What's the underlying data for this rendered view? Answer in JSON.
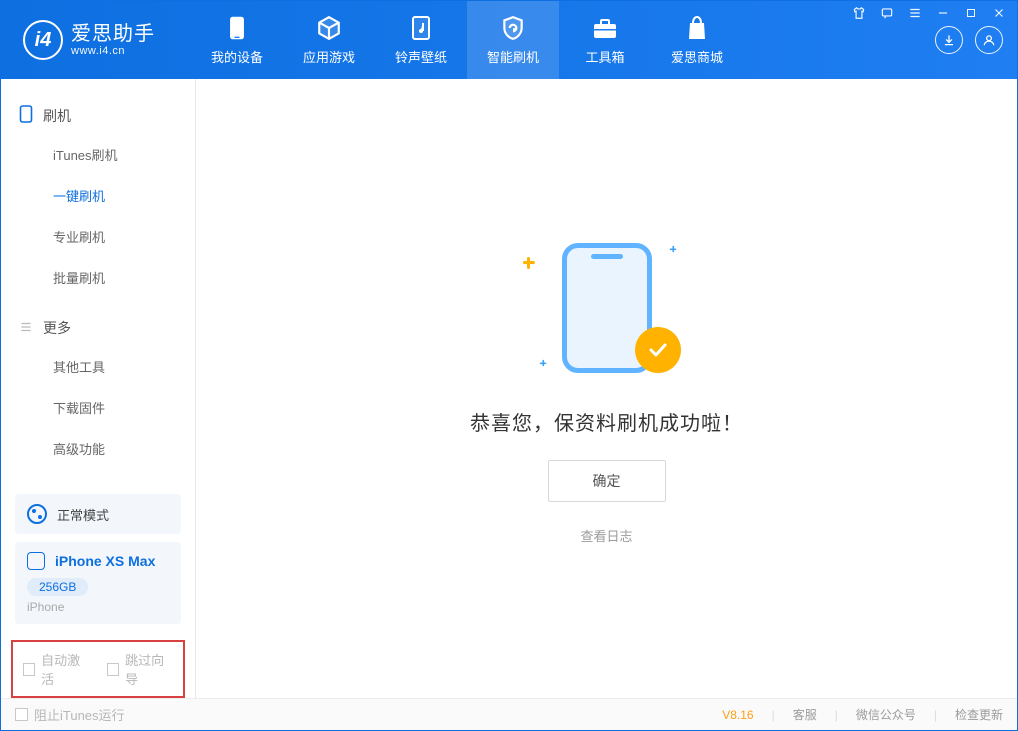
{
  "app": {
    "title": "爱思助手",
    "url": "www.i4.cn"
  },
  "tabs": [
    {
      "label": "我的设备"
    },
    {
      "label": "应用游戏"
    },
    {
      "label": "铃声壁纸"
    },
    {
      "label": "智能刷机"
    },
    {
      "label": "工具箱"
    },
    {
      "label": "爱思商城"
    }
  ],
  "sidebar": {
    "group1": {
      "title": "刷机",
      "items": [
        "iTunes刷机",
        "一键刷机",
        "专业刷机",
        "批量刷机"
      ]
    },
    "group2": {
      "title": "更多",
      "items": [
        "其他工具",
        "下载固件",
        "高级功能"
      ]
    },
    "mode": "正常模式",
    "device": {
      "name": "iPhone XS Max",
      "storage": "256GB",
      "type": "iPhone"
    },
    "check1": "自动激活",
    "check2": "跳过向导"
  },
  "main": {
    "success": "恭喜您，保资料刷机成功啦！",
    "ok": "确定",
    "log": "查看日志"
  },
  "footer": {
    "block_itunes": "阻止iTunes运行",
    "version": "V8.16",
    "links": [
      "客服",
      "微信公众号",
      "检查更新"
    ]
  }
}
